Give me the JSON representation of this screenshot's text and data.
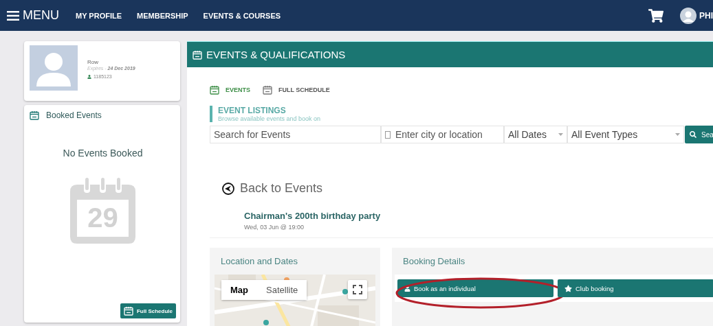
{
  "nav": {
    "menu_label": "MENU",
    "items": [
      {
        "label": "MY PROFILE"
      },
      {
        "label": "MEMBERSHIP"
      },
      {
        "label": "EVENTS & COURSES"
      }
    ],
    "user_name": "PHI"
  },
  "profile": {
    "name": "Row",
    "expires_label": "Expires -",
    "expires_date": "24 Dec 2019",
    "member_number": "1185123"
  },
  "booked_events": {
    "title": "Booked Events",
    "empty_text": "No Events Booked",
    "calendar_day": "29",
    "button": "Full Schedule"
  },
  "main": {
    "title": "EVENTS & QUALIFICATIONS",
    "tabs": [
      {
        "label": "EVENTS",
        "selected": true
      },
      {
        "label": "FULL SCHEDULE",
        "selected": false
      }
    ],
    "listings": {
      "title": "EVENT LISTINGS",
      "subtitle": "Browse available events and book on"
    },
    "search": {
      "query_placeholder": "Search for Events",
      "location_placeholder": "Enter city or location",
      "dates": "All Dates",
      "types": "All Event Types",
      "button": "Sea"
    },
    "back": "Back to Events",
    "event": {
      "title": "Chairman's 200th birthday party",
      "date": "Wed, 03 Jun @ 19:00"
    },
    "location_panel": {
      "title": "Location and Dates",
      "map_types": [
        {
          "label": "Map",
          "selected": true
        },
        {
          "label": "Satellite",
          "selected": false
        }
      ]
    },
    "booking_panel": {
      "title": "Booking Details",
      "buttons": [
        {
          "kind": "individual",
          "label": "Book as an individual",
          "circled": true
        },
        {
          "kind": "club",
          "label": "Club booking",
          "circled": false
        }
      ]
    }
  }
}
